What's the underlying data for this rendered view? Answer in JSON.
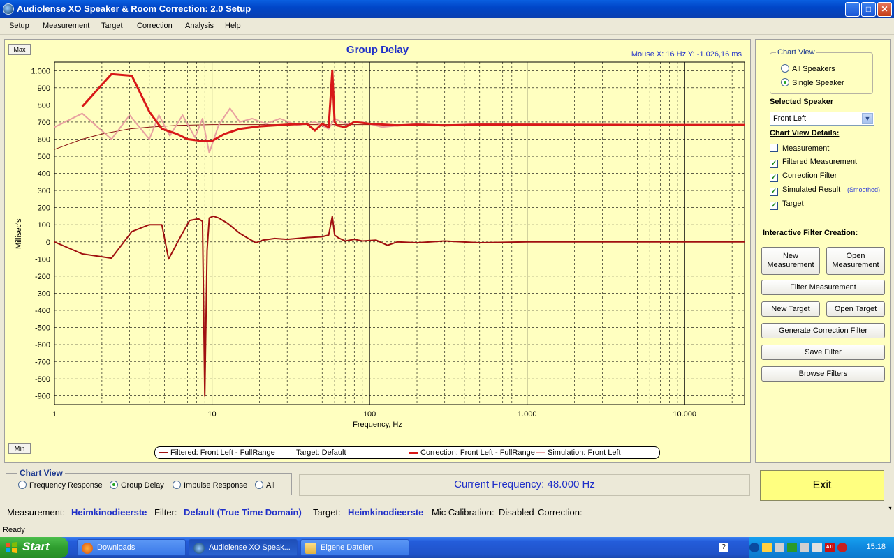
{
  "window": {
    "title": "Audiolense XO Speaker & Room Correction: 2.0 Setup"
  },
  "menu": [
    "Setup",
    "Measurement",
    "Target",
    "Correction",
    "Analysis",
    "Help"
  ],
  "chart_panel": {
    "max_label": "Max",
    "min_label": "Min",
    "mouse_readout": "Mouse X: 16 Hz   Y: -1.026,16 ms"
  },
  "chart_data": {
    "type": "line",
    "title": "Group Delay",
    "xlabel": "Frequency, Hz",
    "ylabel": "Millisec's",
    "xscale": "log",
    "xlim": [
      1,
      24000
    ],
    "ylim": [
      -950,
      1050
    ],
    "xticks": [
      1,
      10,
      100,
      1000,
      10000
    ],
    "xtick_labels": [
      "1",
      "10",
      "100",
      "1.000",
      "10.000"
    ],
    "yticks": [
      1000,
      900,
      800,
      700,
      600,
      500,
      400,
      300,
      200,
      100,
      0,
      -100,
      -200,
      -300,
      -400,
      -500,
      -600,
      -700,
      -800,
      -900
    ],
    "ytick_labels": [
      "1.000",
      "900",
      "800",
      "700",
      "600",
      "500",
      "400",
      "300",
      "200",
      "100",
      "0",
      "-100",
      "-200",
      "-300",
      "-400",
      "-500",
      "-600",
      "-700",
      "-800",
      "-900"
    ],
    "grid": true,
    "legend_position": "bottom",
    "series": [
      {
        "name": "Filtered: Front Left - FullRange",
        "color": "#a01010",
        "width": 2,
        "x": [
          1,
          1.5,
          2.3,
          3.1,
          4.0,
          4.8,
          5.3,
          6.4,
          7.2,
          8.2,
          8.7,
          9.0,
          9.3,
          9.6,
          10.2,
          11,
          12.5,
          15,
          17,
          19,
          21,
          25,
          30,
          40,
          50,
          55,
          58,
          60,
          63,
          70,
          80,
          90,
          110,
          130,
          150,
          200,
          300,
          500,
          1000,
          5000,
          24000
        ],
        "y": [
          0,
          -70,
          -95,
          60,
          100,
          100,
          -100,
          40,
          125,
          135,
          120,
          -900,
          -50,
          140,
          150,
          140,
          110,
          50,
          20,
          -5,
          10,
          20,
          15,
          25,
          30,
          40,
          150,
          40,
          25,
          5,
          15,
          5,
          10,
          -20,
          0,
          -5,
          5,
          -5,
          0,
          0,
          0
        ]
      },
      {
        "name": "Target: Default",
        "color": "#8a1010",
        "width": 1,
        "x": [
          1,
          1.5,
          2,
          3,
          4,
          6,
          10,
          20,
          50,
          100,
          1000,
          24000
        ],
        "y": [
          540,
          600,
          630,
          660,
          670,
          680,
          685,
          685,
          685,
          685,
          685,
          685
        ]
      },
      {
        "name": "Correction: Front Left - FullRange",
        "color": "#d81818",
        "width": 3,
        "x": [
          1.5,
          2.3,
          3.1,
          4.0,
          4.8,
          6,
          7,
          8.5,
          10,
          12,
          15,
          20,
          30,
          40,
          45,
          50,
          55,
          58,
          60,
          62,
          70,
          80,
          100,
          150,
          200,
          300,
          500,
          1000,
          5000,
          24000
        ],
        "y": [
          790,
          980,
          970,
          760,
          660,
          630,
          600,
          590,
          590,
          630,
          660,
          675,
          685,
          690,
          650,
          690,
          670,
          1000,
          700,
          680,
          670,
          700,
          690,
          680,
          685,
          680,
          685,
          685,
          683,
          683
        ]
      },
      {
        "name": "Simulation: Front Left",
        "color": "#e8a0a0",
        "width": 2,
        "x": [
          1,
          1.5,
          2.3,
          3.0,
          4.0,
          4.6,
          5.4,
          6.5,
          7.8,
          8.7,
          9.6,
          11,
          13,
          15,
          18,
          22,
          27,
          35,
          45,
          55,
          60,
          70,
          90,
          120,
          200,
          300,
          500,
          1000,
          3000,
          24000
        ],
        "y": [
          670,
          750,
          600,
          740,
          600,
          740,
          620,
          740,
          610,
          720,
          520,
          680,
          780,
          700,
          720,
          690,
          720,
          680,
          700,
          660,
          720,
          690,
          700,
          670,
          690,
          680,
          690,
          685,
          683,
          683
        ]
      }
    ]
  },
  "right_panel": {
    "chart_view_legend": "Chart View",
    "chart_view_options": [
      {
        "label": "All Speakers",
        "selected": false
      },
      {
        "label": "Single Speaker",
        "selected": true
      }
    ],
    "selected_speaker_heading": "Selected Speaker",
    "selected_speaker_value": "Front Left",
    "details_heading": "Chart View Details:",
    "details": [
      {
        "label": "Measurement",
        "checked": false
      },
      {
        "label": "Filtered Measurement",
        "checked": true
      },
      {
        "label": "Correction Filter",
        "checked": true
      },
      {
        "label": "Simulated Result",
        "checked": true
      },
      {
        "label": "Target",
        "checked": true
      }
    ],
    "smoothed_link": "(Smoothed)",
    "interactive_heading": "Interactive Filter Creation:",
    "buttons": {
      "new_measurement": "New Measurement",
      "open_measurement": "Open Measurement",
      "filter_measurement": "Filter Measurement",
      "new_target": "New Target",
      "open_target": "Open Target",
      "generate_correction": "Generate Correction Filter",
      "save_filter": "Save Filter",
      "browse_filters": "Browse Filters"
    }
  },
  "bottom": {
    "chart_view_legend": "Chart View",
    "options": [
      {
        "label": "Frequency Response",
        "selected": false
      },
      {
        "label": "Group Delay",
        "selected": true
      },
      {
        "label": "Impulse Response",
        "selected": false
      },
      {
        "label": "All",
        "selected": false
      }
    ],
    "current_frequency": "Current Frequency: 48.000 Hz",
    "exit_label": "Exit"
  },
  "info": {
    "measurement_label": "Measurement:",
    "measurement_value": "Heimkinodieerste",
    "filter_label": "Filter:",
    "filter_value": "Default (True Time Domain)",
    "target_label": "Target:",
    "target_value": "Heimkinodieerste",
    "mic_label": "Mic Calibration:",
    "mic_value": "Disabled",
    "correction_label": "Correction:"
  },
  "status": "Ready",
  "taskbar": {
    "start_label": "Start",
    "tasks": [
      {
        "label": "Downloads",
        "active": false
      },
      {
        "label": "Audiolense XO Speak...",
        "active": true
      },
      {
        "label": "Eigene Dateien",
        "active": false
      }
    ],
    "clock": "15:18"
  }
}
